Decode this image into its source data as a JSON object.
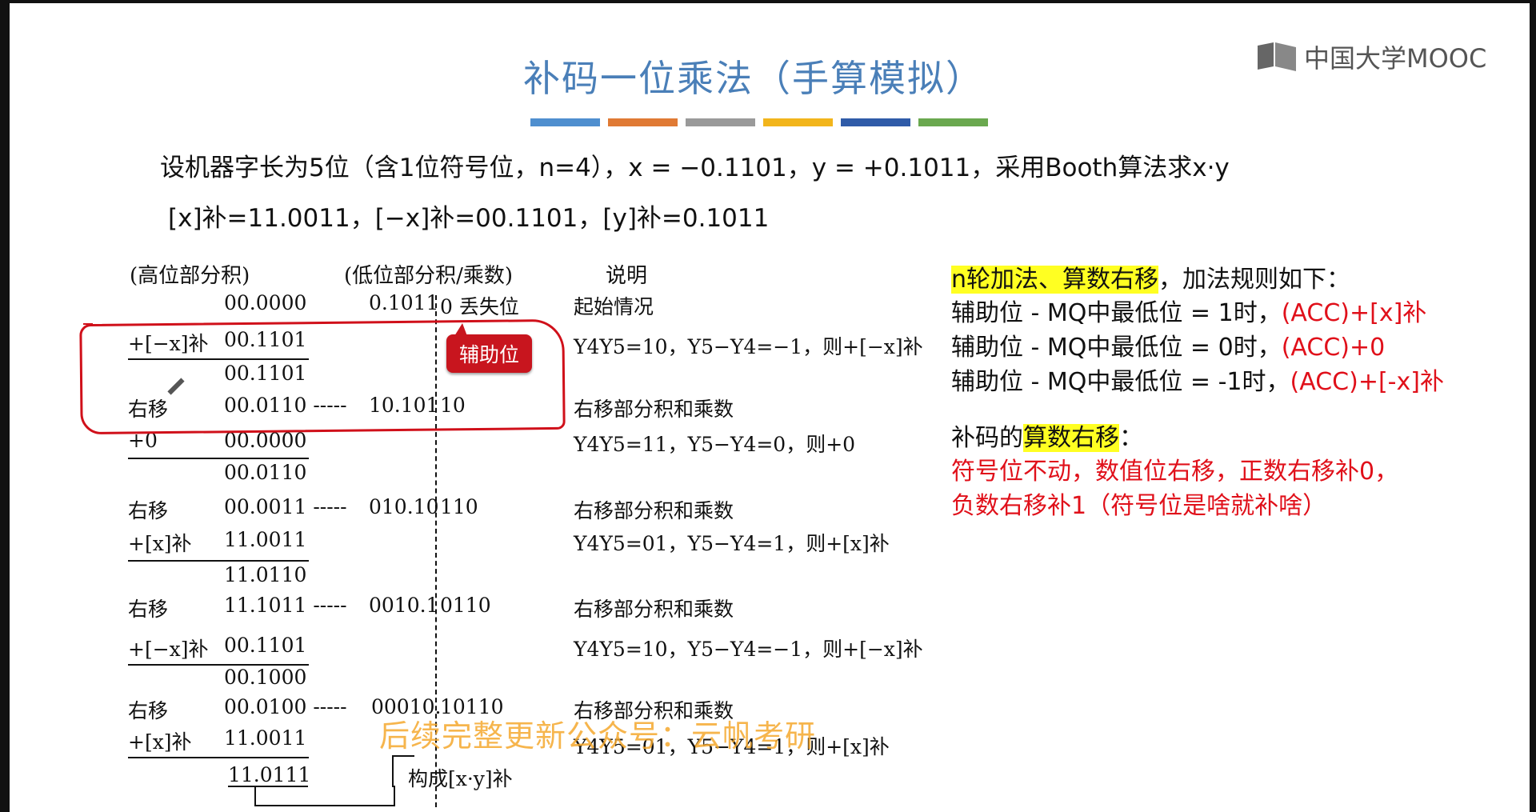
{
  "slide": {
    "title": "补码一位乘法（手算模拟）",
    "logo": "中国大学MOOC",
    "color_bars": [
      "#4f8fcf",
      "#e07a34",
      "#9a9a9a",
      "#f2b51c",
      "#2f5ba8",
      "#6aa84f"
    ],
    "problem_line": "设机器字长为5位（含1位符号位，n=4），x = −0.1101，y = +0.1011，采用Booth算法求x·y",
    "complement_line": "[x]补=11.0011，[−x]补=00.1101，[y]补=0.1011"
  },
  "table": {
    "headers": [
      "(高位部分积)",
      "(低位部分积/乘数)",
      "说明"
    ],
    "rows": [
      {
        "label": "",
        "high": "00.0000",
        "low": "0.1011",
        "aux": "0 丢失位",
        "note": "起始情况"
      },
      {
        "label": "+[−x]补",
        "high": "00.1101",
        "low": "",
        "aux": "",
        "note": "Y4Y5=10，Y5−Y4=−1，则+[−x]补"
      },
      {
        "label": "",
        "high": "00.1101",
        "low": "",
        "aux": "",
        "note": ""
      },
      {
        "label": "右移",
        "high": "00.0110 -----",
        "low": "10.101",
        "aux": "10",
        "note": "右移部分积和乘数"
      },
      {
        "label": "+0",
        "high": "00.0000",
        "low": "",
        "aux": "",
        "note": "Y4Y5=11，Y5−Y4=0，则+0"
      },
      {
        "label": "",
        "high": "00.0110",
        "low": "",
        "aux": "",
        "note": ""
      },
      {
        "label": "右移",
        "high": "00.0011 -----",
        "low": "010.10",
        "aux": "110",
        "note": "右移部分积和乘数"
      },
      {
        "label": "+[x]补",
        "high": "11.0011",
        "low": "",
        "aux": "",
        "note": "Y4Y5=01，Y5−Y4=1，则+[x]补"
      },
      {
        "label": "",
        "high": "11.0110",
        "low": "",
        "aux": "",
        "note": ""
      },
      {
        "label": "右移",
        "high": "11.1011 -----",
        "low": "0010.1",
        "aux": "0110",
        "note": "右移部分积和乘数"
      },
      {
        "label": "+[−x]补",
        "high": "00.1101",
        "low": "",
        "aux": "",
        "note": "Y4Y5=10，Y5−Y4=−1，则+[−x]补"
      },
      {
        "label": "",
        "high": "00.1000",
        "low": "",
        "aux": "",
        "note": ""
      },
      {
        "label": "右移",
        "high": "00.0100 -----",
        "low": "00010.",
        "aux": "10110",
        "note": "右移部分积和乘数"
      },
      {
        "label": "+[x]补",
        "high": "11.0011",
        "low": "",
        "aux": "",
        "note": "Y4Y5=01，Y5−Y4=1，则+[x]补"
      },
      {
        "label": "",
        "high": "11.0111",
        "low": "",
        "aux": "",
        "note": ""
      }
    ],
    "result_label": "构成[x·y]补",
    "callout": "辅助位"
  },
  "rules": {
    "heading_hl": "n轮加法、算数右移",
    "heading_rest": "，加法规则如下：",
    "r1_text": "辅助位 - MQ中最低位 = 1时，",
    "r1_op": "(ACC)+[x]补",
    "r2_text": "辅助位 - MQ中最低位 = 0时，",
    "r2_op": "(ACC)+0",
    "r3_text": "辅助位 - MQ中最低位 = -1时，",
    "r3_op": "(ACC)+[-x]补",
    "shift_pre": "补码的",
    "shift_hl": "算数右移",
    "shift_post": "：",
    "shift_desc1": "符号位不动，数值位右移，正数右移补0，",
    "shift_desc2": "负数右移补1（符号位是啥就补啥）"
  },
  "watermark": "后续完整更新公众号：云帆考研"
}
